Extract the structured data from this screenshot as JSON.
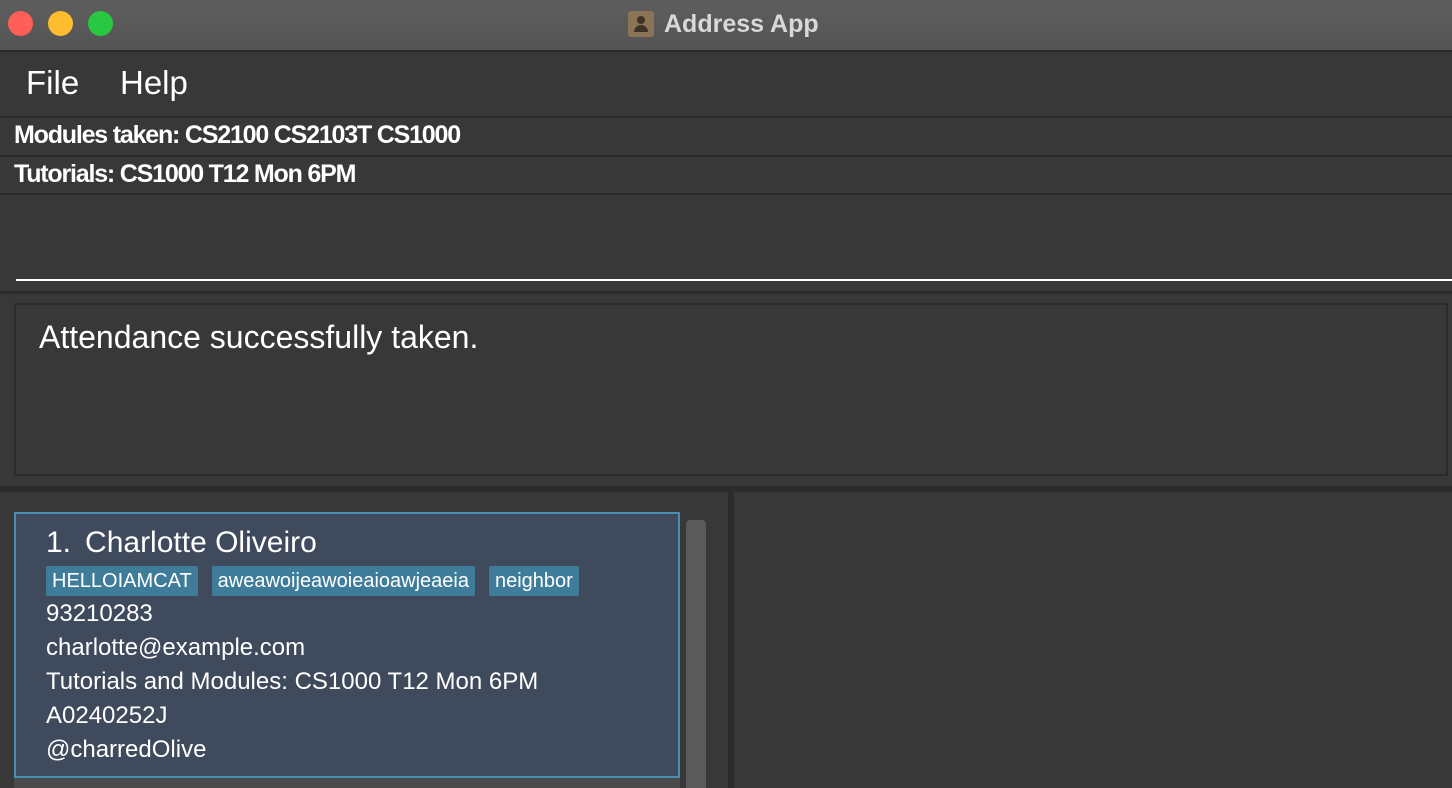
{
  "window": {
    "title": "Address App",
    "icon": "address-book-icon"
  },
  "menu": {
    "file_label": "File",
    "help_label": "Help"
  },
  "info": {
    "modules": "Modules taken: CS2100 CS2103T CS1000",
    "tutorials": "Tutorials: CS1000 T12 Mon 6PM"
  },
  "command": {
    "value": ""
  },
  "result": {
    "message": "Attendance successfully taken."
  },
  "persons": [
    {
      "index": "1.",
      "name": "Charlotte Oliveiro",
      "tags": [
        "HELLOIAMCAT",
        "aweawoijeawoieaioawjeaeia",
        "neighbor"
      ],
      "phone": "93210283",
      "email": "charlotte@example.com",
      "tutorials": "Tutorials and Modules: CS1000 T12 Mon 6PM",
      "student_id": "A0240252J",
      "telegram": "@charredOlive"
    }
  ],
  "colors": {
    "background": "#383838",
    "card": "#3f4a5c",
    "card_border": "#4a8fb0",
    "tag": "#3e7c9a"
  }
}
